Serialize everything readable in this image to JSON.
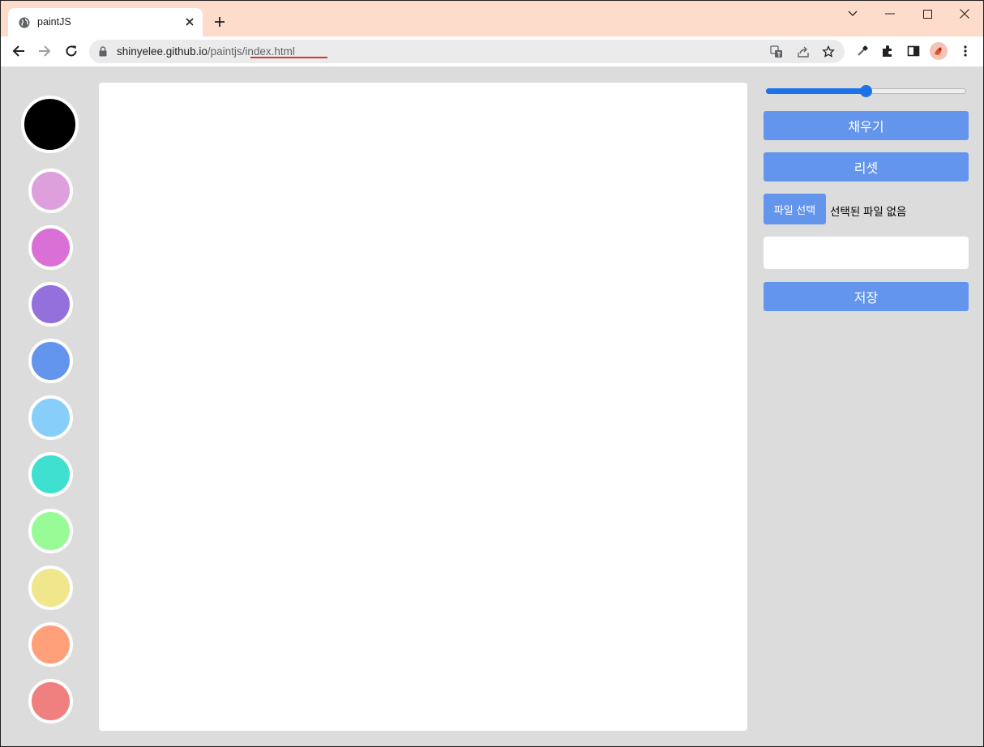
{
  "browser": {
    "tab_title": "paintJS",
    "url_host": "shinyelee.github.io",
    "url_path": "/paintjs/index.html"
  },
  "palette": {
    "selected_color": "#000000",
    "colors": [
      "#000000",
      "#dda0dd",
      "#da70d6",
      "#9370db",
      "#6495ed",
      "#87cefa",
      "#40e0d0",
      "#98fb98",
      "#f0e68c",
      "#ffa07a",
      "#f08080"
    ]
  },
  "controls": {
    "range_value": 0.5,
    "fill_label": "채우기",
    "reset_label": "리셋",
    "file_button_label": "파일 선택",
    "file_status": "선택된 파일 없음",
    "text_input_value": "",
    "save_label": "저장"
  },
  "colors": {
    "tabstrip": "#fddccb",
    "button": "#6495ed",
    "page_bg": "#dcdcdc"
  }
}
